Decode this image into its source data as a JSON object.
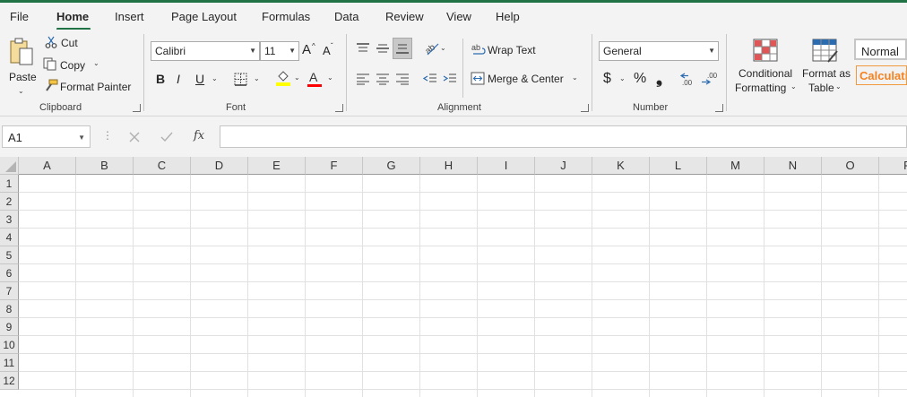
{
  "tabs": [
    "File",
    "Home",
    "Insert",
    "Page Layout",
    "Formulas",
    "Data",
    "Review",
    "View",
    "Help"
  ],
  "active_tab": "Home",
  "clipboard": {
    "paste_label": "Paste",
    "cut_label": "Cut",
    "copy_label": "Copy",
    "format_painter_label": "Format Painter",
    "group_label": "Clipboard"
  },
  "font": {
    "font_name": "Calibri",
    "font_size": "11",
    "bold": "B",
    "italic": "I",
    "underline": "U",
    "group_label": "Font",
    "grow_glyph": "A",
    "shrink_glyph": "A",
    "font_color_glyph": "A",
    "fill_color": "#ffff00",
    "font_color": "#ff0000"
  },
  "alignment": {
    "wrap_text_label": "Wrap Text",
    "merge_center_label": "Merge & Center",
    "group_label": "Alignment"
  },
  "number": {
    "format_value": "General",
    "currency_glyph": "$",
    "percent_glyph": "%",
    "comma_glyph": "❟",
    "group_label": "Number"
  },
  "styles": {
    "conditional_formatting_line1": "Conditional",
    "conditional_formatting_line2": "Formatting",
    "format_as_table_line1": "Format as",
    "format_as_table_line2": "Table",
    "normal_style": "Normal",
    "calculation_style": "Calculatio"
  },
  "formula_bar": {
    "name_box": "A1",
    "fx_label": "fx",
    "formula_value": ""
  },
  "columns": [
    "A",
    "B",
    "C",
    "D",
    "E",
    "F",
    "G",
    "H",
    "I",
    "J",
    "K",
    "L",
    "M",
    "N",
    "O",
    "P"
  ],
  "rows": [
    "1",
    "2",
    "3",
    "4",
    "5",
    "6",
    "7",
    "8",
    "9",
    "10",
    "11",
    "12"
  ],
  "colors": {
    "accent": "#217346",
    "ribbon_bg": "#f3f3f3"
  }
}
